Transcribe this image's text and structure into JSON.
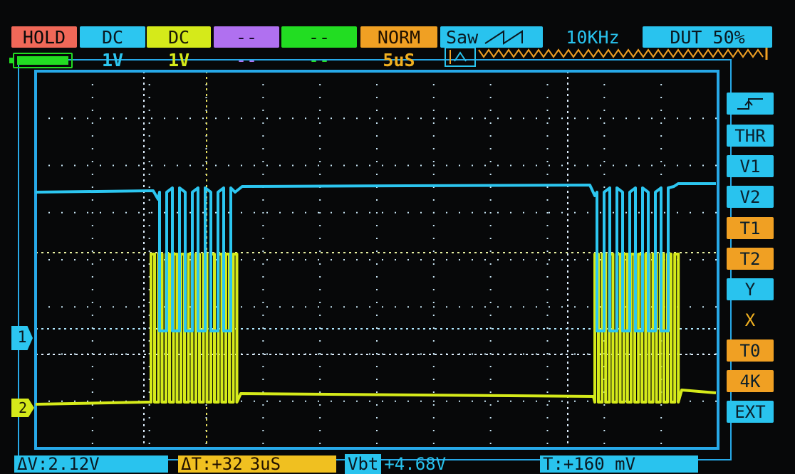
{
  "top_bar": {
    "hold": "HOLD",
    "ch1_coupling": "DC",
    "ch1_volts": "1V",
    "ch2_coupling": "DC",
    "ch2_volts": "1V",
    "ch3_coupling": "--",
    "ch3_volts": "--",
    "ch4_coupling": "--",
    "ch4_volts": "--",
    "trigger_mode": "NORM",
    "timebase": "5uS",
    "generator_wave": "Saw",
    "generator_freq": "10KHz",
    "duty": "DUT 50%"
  },
  "battery": {
    "level_percent": 100
  },
  "channel_markers": {
    "ch1": "1",
    "ch2": "2"
  },
  "menu": [
    {
      "label": "THR",
      "style": "cyan"
    },
    {
      "label": "V1",
      "style": "cyan"
    },
    {
      "label": "V2",
      "style": "cyan"
    },
    {
      "label": "T1",
      "style": "orange"
    },
    {
      "label": "T2",
      "style": "orange"
    },
    {
      "label": "Y",
      "style": "cyan"
    },
    {
      "label": "X",
      "style": "plain"
    },
    {
      "label": "T0",
      "style": "orange"
    },
    {
      "label": "4K",
      "style": "orange"
    },
    {
      "label": "EXT",
      "style": "cyan"
    }
  ],
  "bottom_bar": {
    "dv": "ΔV:2.12V",
    "dt_label": "ΔT:+32",
    "dt_value": "3uS",
    "vbt_label": "Vbt",
    "vbt_value": "+4.68V",
    "t_value": "T:+160 mV"
  },
  "colors": {
    "ch1": "#2cc6f0",
    "ch2": "#d5ea1a",
    "frame": "#27a9e8",
    "ch3": "#b070f0",
    "ch4": "#22dd22",
    "orange": "#f0a023",
    "hold_bg": "#f06858"
  }
}
